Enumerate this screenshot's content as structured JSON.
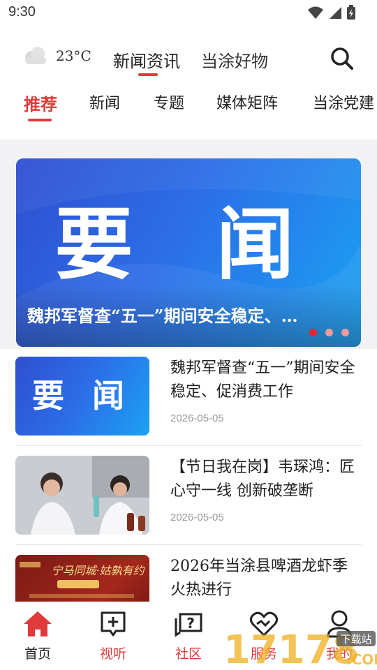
{
  "status_bar": {
    "time": "9:30"
  },
  "header": {
    "weather_temp": "23°C",
    "tabs": [
      {
        "label": "新闻资讯",
        "active": true
      },
      {
        "label": "当涂好物",
        "active": false
      }
    ]
  },
  "channels": [
    "推荐",
    "新闻",
    "专题",
    "媒体矩阵",
    "当涂党建"
  ],
  "banner": {
    "image_text": "要 闻",
    "title": "魏邦军督查“五一”期间安全稳定、…",
    "page_count": 3,
    "current_page": 1
  },
  "news": [
    {
      "title": "魏邦军督查“五一”期间安全稳定、促消费工作",
      "date": "2026-05-05",
      "thumb_text": "要 闻"
    },
    {
      "title": "【节日我在岗】韦琛鸿：匠心守一线 创新破垄断",
      "date": "2026-05-05"
    },
    {
      "title": "2026年当涂县啤酒龙虾季火热进行",
      "thumb_text": "宁马同城·姑孰有约"
    }
  ],
  "bottom_nav": [
    {
      "label": "首页",
      "icon": "home-icon"
    },
    {
      "label": "视听",
      "icon": "add-video-icon"
    },
    {
      "label": "社区",
      "icon": "question-chat-icon"
    },
    {
      "label": "服务",
      "icon": "heart-hands-icon"
    },
    {
      "label": "我的",
      "icon": "user-icon"
    }
  ],
  "watermark": {
    "text": "17178",
    "sub": "下载站",
    "suffix": ".COM"
  },
  "colors": {
    "accent": "#e03a3a",
    "banner_blue": "#2c6ee8"
  }
}
